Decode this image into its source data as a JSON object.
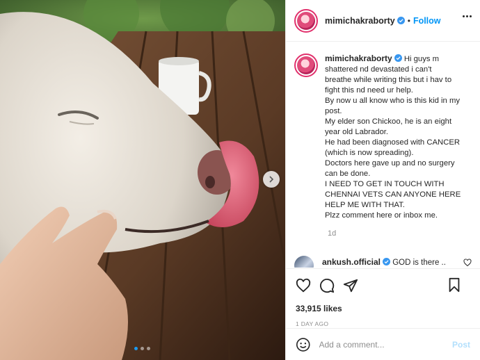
{
  "post": {
    "username": "mimichakraborty",
    "follow_label": "Follow",
    "separator": "•",
    "caption_lines": [
      "Hi guys m",
      "shattered nd devastated i can't",
      "breathe while writing this but i hav to",
      "fight this nd need ur help.",
      "By now u all know who is this kid in my",
      "post.",
      "My elder son Chickoo, he is an eight",
      "year old Labrador.",
      "He had been diagnosed with CANCER",
      "(which is now spreading).",
      "Doctors here gave up and no surgery",
      "can be done.",
      "I NEED TO GET IN TOUCH WITH",
      "CHENNAI VETS CAN ANYONE HERE",
      "HELP ME WITH THAT.",
      "Plzz comment here or inbox me."
    ],
    "caption_time": "1d"
  },
  "comment": {
    "username": "ankush.official",
    "text": "GOD is there .."
  },
  "stats": {
    "likes": "33,915 likes",
    "date": "1 DAY AGO"
  },
  "composer": {
    "placeholder": "Add a comment...",
    "post_label": "Post"
  },
  "carousel": {
    "total": 3,
    "active_index": 1
  },
  "colors": {
    "link_blue": "#0095f6",
    "verified_blue": "#3897f0",
    "post_disabled": "#b2dffc",
    "active_dot": "#1c9bf0"
  },
  "icons": {
    "like": "heart-icon",
    "comment": "comment-icon",
    "share": "paper-plane-icon",
    "save": "bookmark-icon",
    "emoji": "emoji-icon",
    "verified": "verified-badge-icon",
    "more": "more-options-icon",
    "next": "chevron-right-icon"
  }
}
